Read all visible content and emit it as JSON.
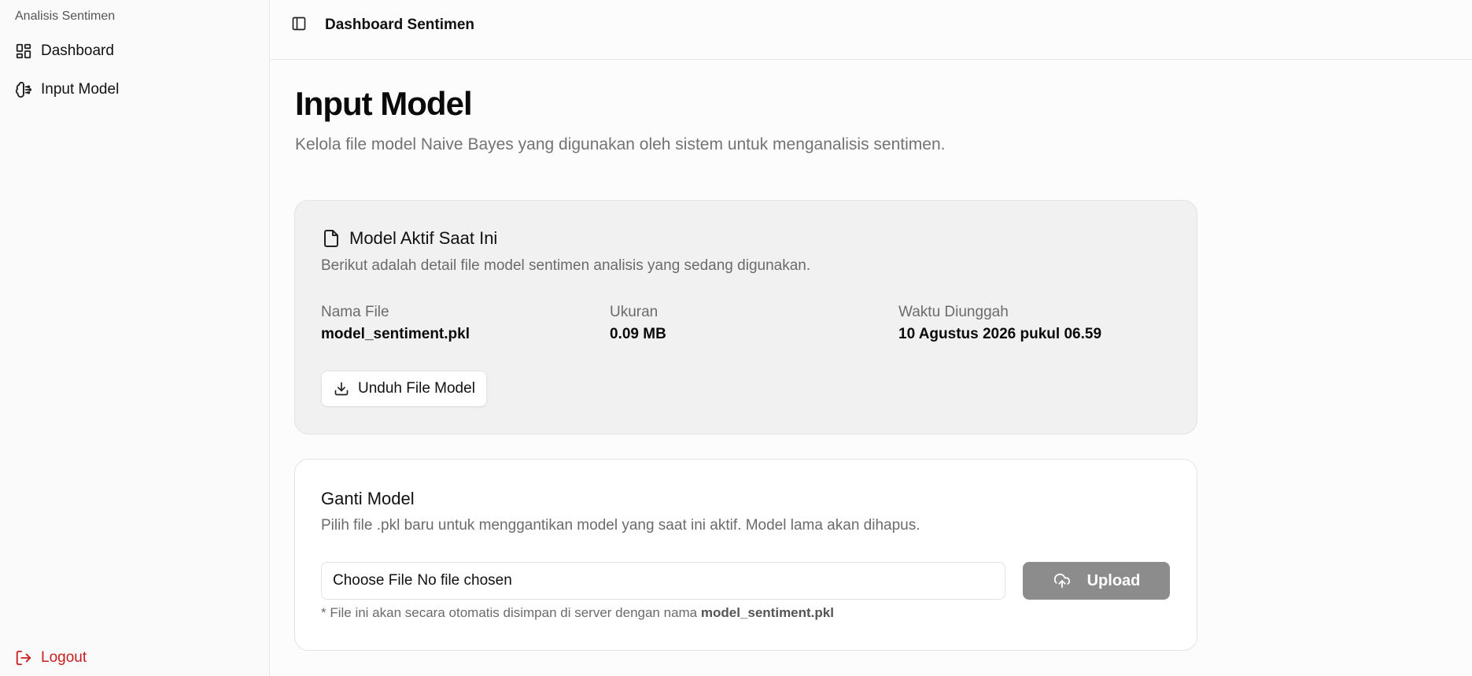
{
  "sidebar": {
    "group_label": "Analisis Sentimen",
    "items": [
      {
        "label": "Dashboard",
        "icon": "dashboard-icon"
      },
      {
        "label": "Input Model",
        "icon": "brain-icon"
      }
    ],
    "logout": {
      "label": "Logout",
      "icon": "logout-icon",
      "color": "#c81e1e"
    }
  },
  "header": {
    "title": "Dashboard Sentimen",
    "toggle_icon": "sidebar-toggle-icon"
  },
  "main": {
    "title": "Input Model",
    "subtitle": "Kelola file model Naive Bayes yang digunakan oleh sistem untuk menganalisis sentimen.",
    "active_model": {
      "icon": "file-icon",
      "title": "Model Aktif Saat Ini",
      "description": "Berikut adalah detail file model sentimen analisis yang sedang digunakan.",
      "fields": [
        {
          "label": "Nama File",
          "value": "model_sentiment.pkl"
        },
        {
          "label": "Ukuran",
          "value": "0.09 MB"
        },
        {
          "label": "Waktu Diunggah",
          "value": "10 Agustus 2026 pukul 06.59"
        }
      ],
      "download_label": "Unduh File Model",
      "download_icon": "download-icon"
    },
    "replace_model": {
      "title": "Ganti Model",
      "description": "Pilih file .pkl baru untuk menggantikan model yang saat ini aktif. Model lama akan dihapus.",
      "choose_label": "Choose File",
      "file_status": "No file chosen",
      "upload_label": "Upload",
      "upload_icon": "cloud-upload-icon",
      "note_prefix": "* File ini akan secara otomatis disimpan di server dengan nama",
      "note_filename": "model_sentiment.pkl"
    }
  }
}
